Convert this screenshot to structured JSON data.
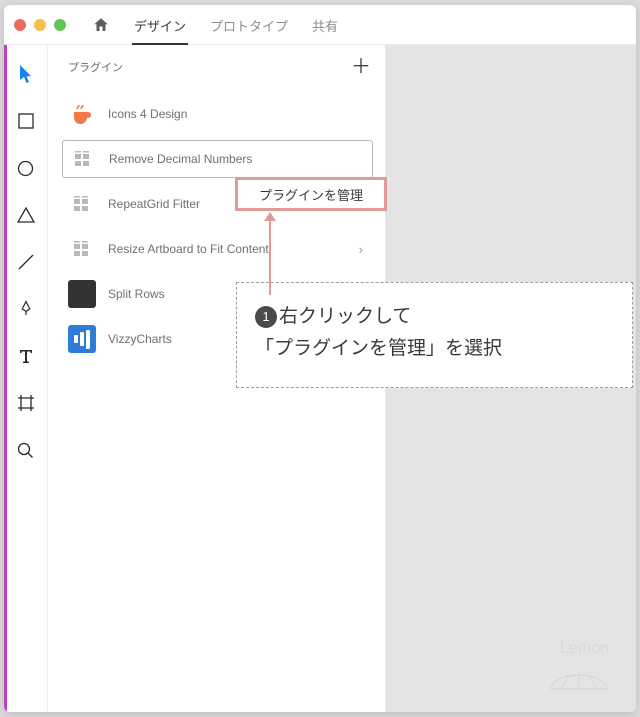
{
  "tabs": {
    "design": "デザイン",
    "prototype": "プロトタイプ",
    "share": "共有"
  },
  "panel": {
    "title": "プラグイン"
  },
  "plugins": {
    "icons4": "Icons 4 Design",
    "decimal": "Remove Decimal Numbers",
    "repeat": "RepeatGrid Fitter",
    "resize": "Resize Artboard to Fit Content",
    "split": "Split Rows",
    "vizzy": "VizzyCharts"
  },
  "context": {
    "manage": "プラグインを管理"
  },
  "callout": {
    "num": "1",
    "line1": "右クリックして",
    "line2": "「プラグインを管理」を選択"
  }
}
